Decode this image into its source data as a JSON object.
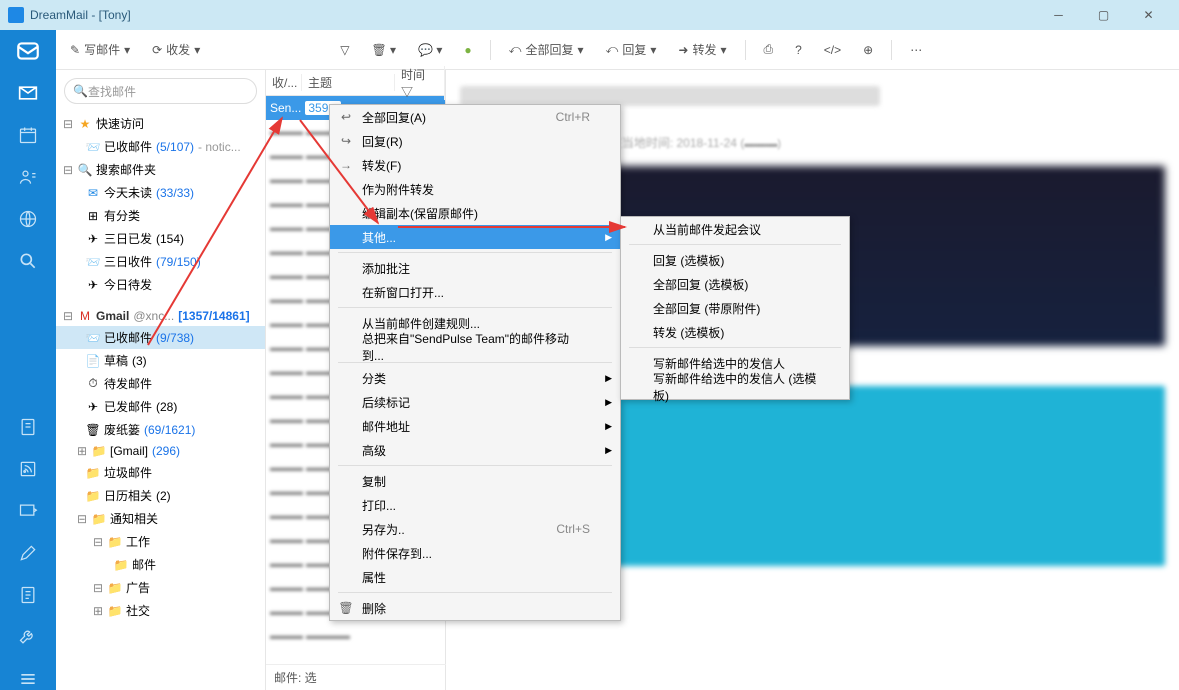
{
  "window": {
    "title": "DreamMail - [Tony]"
  },
  "toolbar": {
    "compose": "写邮件",
    "sync": "收发"
  },
  "search": {
    "placeholder": "查找邮件"
  },
  "sidebar": {
    "quick": {
      "label": "快速访问"
    },
    "inbox": {
      "label": "已收邮件",
      "count": "(5/107)",
      "extra": "- notic..."
    },
    "searchFolders": {
      "label": "搜索邮件夹"
    },
    "unread": {
      "label": "今天未读",
      "count": "(33/33)"
    },
    "tagged": {
      "label": "有分类"
    },
    "sent3": {
      "label": "三日已发",
      "count": "(154)"
    },
    "recv3": {
      "label": "三日收件",
      "count": "(79/150)"
    },
    "todo": {
      "label": "今日待发"
    },
    "gmail": {
      "label": "Gmail",
      "acct": "@xnc...",
      "count": "[1357/14861]"
    },
    "ginbox": {
      "label": "已收邮件",
      "count": "(9/738)"
    },
    "drafts": {
      "label": "草稿",
      "count": "(3)"
    },
    "outbox": {
      "label": "待发邮件"
    },
    "sentbox": {
      "label": "已发邮件",
      "count": "(28)"
    },
    "trash": {
      "label": "废纸篓",
      "count": "(69/1621)"
    },
    "gfolder": {
      "label": "[Gmail]",
      "count": "(296)"
    },
    "spam": {
      "label": "垃圾邮件"
    },
    "calendar": {
      "label": "日历相关",
      "count": "(2)"
    },
    "notify": {
      "label": "通知相关"
    },
    "work": {
      "label": "工作"
    },
    "mails": {
      "label": "邮件"
    },
    "ads": {
      "label": "广告"
    },
    "social": {
      "label": "社交"
    }
  },
  "listHeader": {
    "c1": "收/...",
    "c2": "主题",
    "c3": "时间"
  },
  "listSel": {
    "from": "Sen...",
    "badge": "359..."
  },
  "listFooter": "邮件: 选",
  "pvToolbar": {
    "replyall": "全部回复",
    "reply": "回复",
    "forward": "转发"
  },
  "pvDate": "11-23 (周五) 14:09]发送，现在当地时间: 2018-11-24 (",
  "menu1": [
    {
      "icon": "↩",
      "label": "全部回复(A)",
      "sc": "Ctrl+R"
    },
    {
      "icon": "↪",
      "label": "回复(R)"
    },
    {
      "icon": "→",
      "label": "转发(F)"
    },
    {
      "label": "作为附件转发"
    },
    {
      "label": "编辑副本(保留原邮件)"
    },
    {
      "label": "其他...",
      "hover": true,
      "sub": true
    },
    {
      "sep": true
    },
    {
      "label": "添加批注"
    },
    {
      "label": "在新窗口打开..."
    },
    {
      "sep": true
    },
    {
      "label": "从当前邮件创建规则..."
    },
    {
      "label": "总把来自\"SendPulse Team\"的邮件移动到..."
    },
    {
      "sep": true
    },
    {
      "label": "分类",
      "sub": true
    },
    {
      "label": "后续标记",
      "sub": true
    },
    {
      "label": "邮件地址",
      "sub": true
    },
    {
      "label": "高级",
      "sub": true
    },
    {
      "sep": true
    },
    {
      "label": "复制"
    },
    {
      "label": "打印..."
    },
    {
      "label": "另存为..",
      "sc": "Ctrl+S"
    },
    {
      "label": "附件保存到..."
    },
    {
      "label": "属性"
    },
    {
      "sep": true
    },
    {
      "icon": "🗑",
      "label": "删除"
    }
  ],
  "menu2": [
    {
      "label": "从当前邮件发起会议"
    },
    {
      "sep": true
    },
    {
      "label": "回复 (选模板)"
    },
    {
      "label": "全部回复 (选模板)"
    },
    {
      "label": "全部回复 (带原附件)"
    },
    {
      "label": "转发 (选模板)"
    },
    {
      "sep": true
    },
    {
      "label": "写新邮件给选中的发信人"
    },
    {
      "label": "写新邮件给选中的发信人 (选模板)"
    }
  ]
}
